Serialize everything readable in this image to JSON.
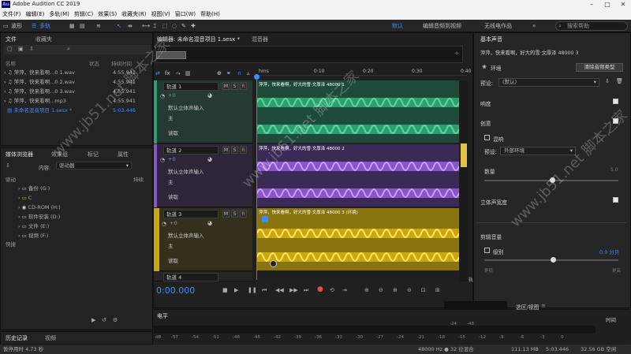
{
  "window": {
    "title": "Adobe Audition CC 2019",
    "icon": "Au"
  },
  "menu": [
    "文件(F)",
    "编辑(E)",
    "多轨(M)",
    "剪辑(C)",
    "效果(S)",
    "收藏夹(R)",
    "视图(V)",
    "窗口(W)",
    "帮助(H)"
  ],
  "toolbar": {
    "waveform": "波形",
    "multitrack": "多轨",
    "workspaces": [
      "默认",
      "编辑音频到视频",
      "无线电作品"
    ],
    "search_placeholder": "搜索帮助"
  },
  "files_panel": {
    "tabs": [
      "文件",
      "收藏夹"
    ],
    "headers": {
      "name": "名称",
      "status": "状态",
      "duration": "持续时间"
    },
    "rows": [
      {
        "name": "萍萍，快来看啊...0 1.wav",
        "duration": "4:55.941"
      },
      {
        "name": "萍萍，快来看啊...0 2.wav",
        "duration": "4:55.941"
      },
      {
        "name": "萍萍，快来看啊...0 3.wav",
        "duration": "4:55.941"
      },
      {
        "name": "萍萍，快来看啊...mp3",
        "duration": "4:55.941"
      },
      {
        "name": "未命名混音项目 1.sesx *",
        "duration": "5:03.446"
      }
    ]
  },
  "media_panel": {
    "tabs": [
      "媒体浏览器",
      "效果组",
      "标记",
      "属性"
    ],
    "content_label": "内容:",
    "content_value": "驱动器",
    "duration_header": "持续",
    "drive_root": "驱动",
    "drives": [
      "备份 (G:)",
      "C",
      "CD-ROM (H:)",
      "软件安装 (D:)",
      "文件 (E:)",
      "视频 (F:)"
    ],
    "shortcuts": "快捷"
  },
  "history_panel": {
    "tabs": [
      "历史记录",
      "视频"
    ]
  },
  "editor": {
    "tab": "编辑器: 未命名混音项目 1.sesx *",
    "mixer_tab": "混音器",
    "ruler": {
      "start": "hms",
      "marks": [
        "0:10",
        "0:20",
        "0:30",
        "0:40"
      ]
    },
    "tracks": [
      {
        "name": "轨道 1",
        "volume": "+0",
        "input": "默认立体声输入",
        "output": "主",
        "read": "读取",
        "clip": "萍萍，快来看啊，好大的雪·文厚泽 48000 1",
        "color": "#2e9e70"
      },
      {
        "name": "轨道 2",
        "volume": "+0",
        "input": "默认立体声输入",
        "output": "主",
        "read": "读取",
        "clip": "萍萍，快来看啊，好大的雪·文厚泽 48000 2",
        "color": "#8a55c8"
      },
      {
        "name": "轨道 3",
        "volume": "+0",
        "input": "默认立体声输入",
        "output": "主",
        "read": "读取",
        "clip": "萍萍，快来看啊，好大的雪·文厚泽 48000 3 (环境)",
        "color": "#c8a80e"
      },
      {
        "name": "轨道 4"
      }
    ],
    "time": "0:00.000",
    "partial_label": "轨道 4"
  },
  "meter": {
    "title": "电平",
    "scale": [
      "dB",
      "-57",
      "-54",
      "-51",
      "-48",
      "-45",
      "-42",
      "-39",
      "-36",
      "-33",
      "-30",
      "-27",
      "-24",
      "-21",
      "-18",
      "-15",
      "-12",
      "-9",
      "-6",
      "-3",
      "0"
    ]
  },
  "selection": {
    "label": "选区/视图",
    "time_label": "时间",
    "values": [
      "-24",
      "-48"
    ]
  },
  "essential_sound": {
    "title": "基本声音",
    "clip_name": "萍萍，快来看啊，好大的雪·文厚泽 48000 3",
    "type": "环境",
    "clear_button": "清除音频类型",
    "preset_label": "预设:",
    "preset_value": "(默认)",
    "loudness": "响度",
    "creative": "创意",
    "reverb": "混响",
    "reverb_preset_label": "预设:",
    "reverb_preset_value": "外部环境",
    "amount": "数量",
    "amount_max": "5.0",
    "stereo_width": "立体声宽度",
    "clip_volume": "剪辑音量",
    "level": "级别",
    "level_value": "0.0 分贝",
    "quieter": "更低",
    "louder": "更高"
  },
  "status": {
    "left": "暂停用时 4.73 秒",
    "sample": "48000 Hz ● 32 位混合",
    "size": "111.13 MB",
    "duration": "5:03.446",
    "free": "32.56 GB 空闲"
  },
  "watermark": "www.jb51.net 脚本之家",
  "colors": {
    "accent": "#2d8cff",
    "track1": "#2e9e70",
    "track2": "#8a55c8",
    "track3": "#c8a80e"
  }
}
